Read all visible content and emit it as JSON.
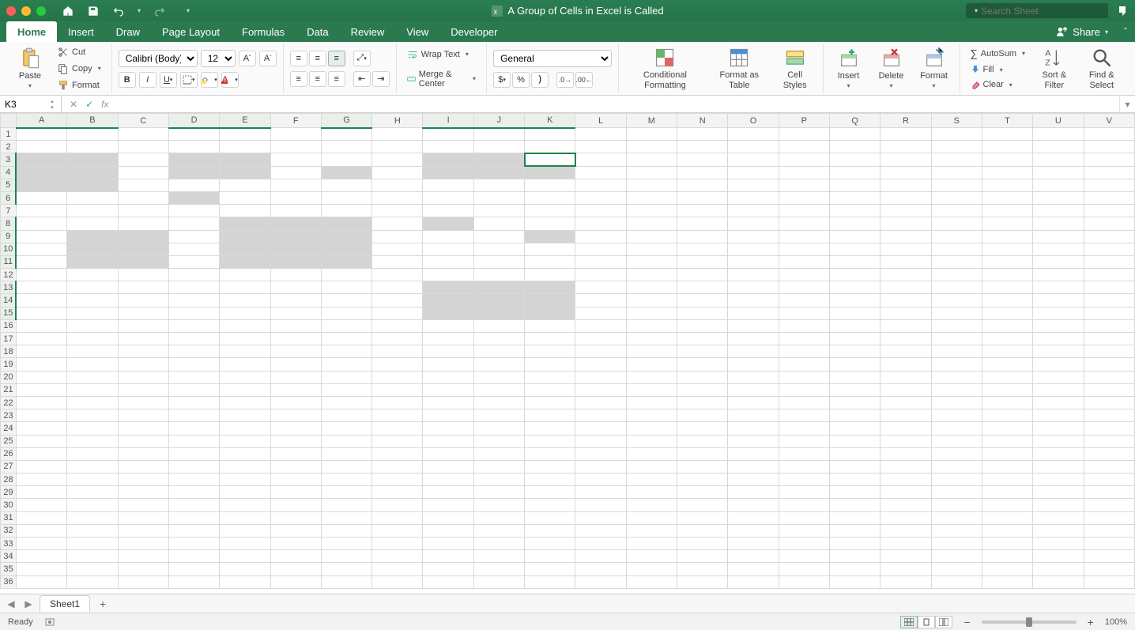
{
  "titlebar": {
    "doc_title": "A Group of Cells in Excel is Called",
    "search_placeholder": "Search Sheet"
  },
  "tabs": {
    "items": [
      "Home",
      "Insert",
      "Draw",
      "Page Layout",
      "Formulas",
      "Data",
      "Review",
      "View",
      "Developer"
    ],
    "active": "Home",
    "share_label": "Share"
  },
  "ribbon": {
    "clipboard": {
      "paste": "Paste",
      "cut": "Cut",
      "copy": "Copy",
      "format": "Format"
    },
    "font": {
      "name": "Calibri (Body)",
      "size": "12"
    },
    "alignment": {
      "wrap": "Wrap Text",
      "merge": "Merge & Center"
    },
    "number": {
      "format": "General"
    },
    "styles": {
      "cond": "Conditional Formatting",
      "table": "Format as Table",
      "cell": "Cell Styles"
    },
    "cells": {
      "insert": "Insert",
      "delete": "Delete",
      "format": "Format"
    },
    "editing": {
      "autosum": "AutoSum",
      "fill": "Fill",
      "clear": "Clear",
      "sort": "Sort & Filter",
      "find": "Find & Select"
    }
  },
  "formula_bar": {
    "name_box": "K3",
    "fx_label": "fx",
    "formula": ""
  },
  "grid": {
    "columns": [
      "A",
      "B",
      "C",
      "D",
      "E",
      "F",
      "G",
      "H",
      "I",
      "J",
      "K",
      "L",
      "M",
      "N",
      "O",
      "P",
      "Q",
      "R",
      "S",
      "T",
      "U",
      "V"
    ],
    "rows": 36,
    "active_cell": "K3",
    "highlighted_cols": [
      "A",
      "B",
      "D",
      "E",
      "G",
      "I",
      "J",
      "K"
    ],
    "highlighted_rows": [
      3,
      4,
      5,
      6,
      8,
      9,
      10,
      11,
      13,
      14,
      15
    ],
    "shaded": [
      "A3",
      "B3",
      "A4",
      "B4",
      "A5",
      "B5",
      "D3",
      "E3",
      "D4",
      "E4",
      "D6",
      "G4",
      "I3",
      "J3",
      "I4",
      "J4",
      "K4",
      "B9",
      "C9",
      "B10",
      "C10",
      "B11",
      "C11",
      "E8",
      "F8",
      "G8",
      "E9",
      "F9",
      "G9",
      "E10",
      "F10",
      "G10",
      "E11",
      "F11",
      "G11",
      "I8",
      "K9",
      "I13",
      "J13",
      "K13",
      "I14",
      "J14",
      "K14",
      "I15",
      "J15",
      "K15"
    ]
  },
  "sheet_tabs": {
    "active": "Sheet1"
  },
  "statusbar": {
    "ready": "Ready",
    "zoom": "100%"
  }
}
